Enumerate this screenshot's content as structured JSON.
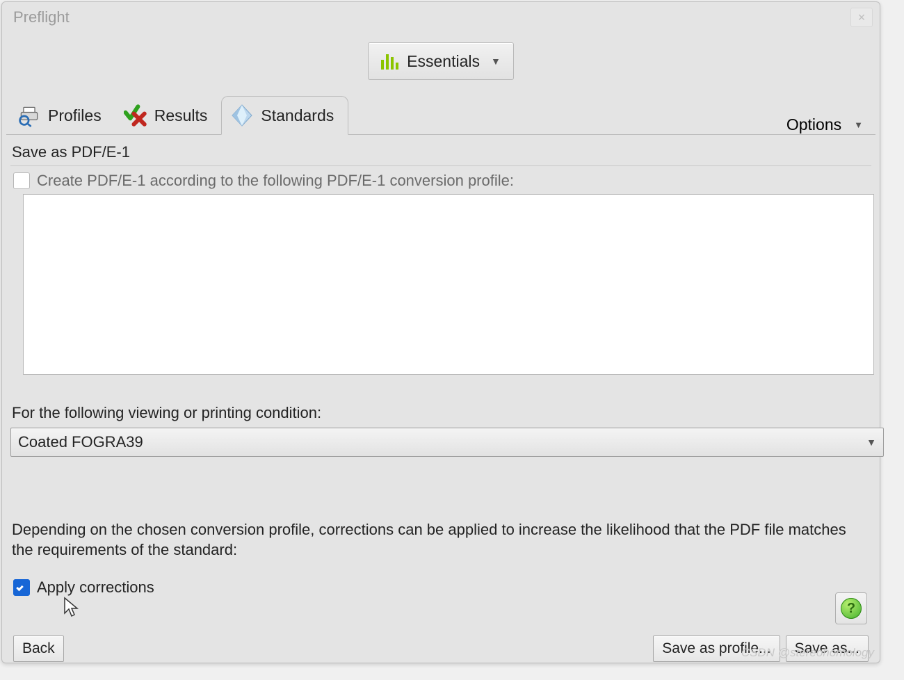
{
  "window": {
    "title": "Preflight"
  },
  "toolstrip": {
    "essentials_label": "Essentials"
  },
  "tabs": {
    "profiles": "Profiles",
    "results": "Results",
    "standards": "Standards",
    "options": "Options"
  },
  "section": {
    "title": "Save as PDF/E-1",
    "create_profile_label": "Create PDF/E-1 according to the following PDF/E-1 conversion profile:"
  },
  "condition": {
    "label": "For the following viewing or printing condition:",
    "selected": "Coated FOGRA39"
  },
  "corrections": {
    "description": "Depending on the chosen conversion profile, corrections can be applied to increase the likelihood that the PDF file matches the requirements of the standard:",
    "apply_label": "Apply corrections"
  },
  "buttons": {
    "back": "Back",
    "save_profile": "Save as profile...",
    "save_as": "Save as..."
  },
  "watermark": "CSDN @stereohomology",
  "help_glyph": "?"
}
